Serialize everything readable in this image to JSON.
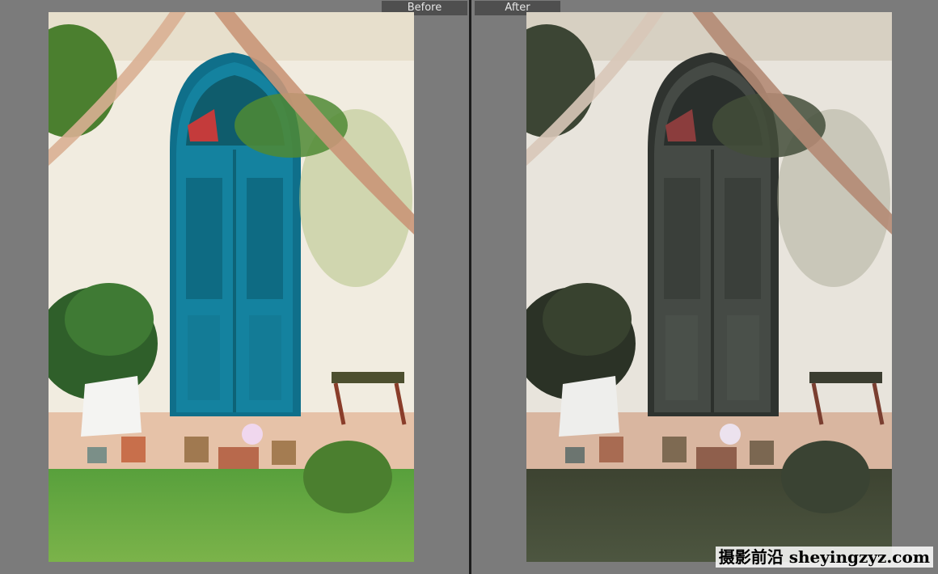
{
  "compare_view": {
    "before_label": "Before",
    "after_label": "After"
  },
  "photo": {
    "subject": "arched-door-garden-scene",
    "before_door_color": "#14829f",
    "after_door_color": "#454a45"
  },
  "watermark": {
    "text": "摄影前沿 sheyingzyz.com"
  }
}
